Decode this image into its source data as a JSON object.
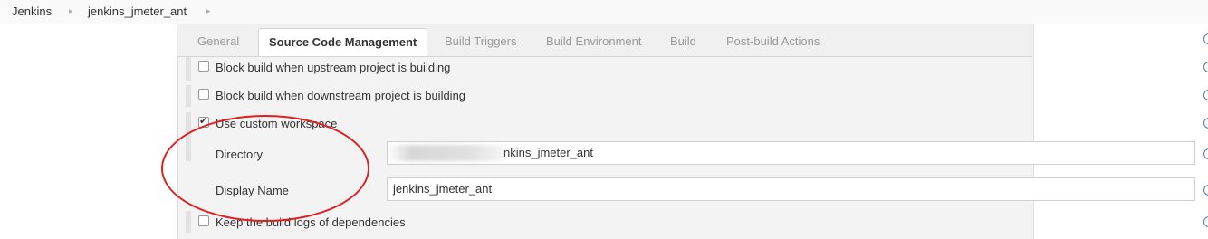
{
  "breadcrumb": {
    "items": [
      {
        "label": "Jenkins"
      },
      {
        "label": "jenkins_jmeter_ant"
      }
    ],
    "separator": "▸"
  },
  "tabs": [
    {
      "label": "General",
      "active": false
    },
    {
      "label": "Source Code Management",
      "active": true
    },
    {
      "label": "Build Triggers",
      "active": false
    },
    {
      "label": "Build Environment",
      "active": false
    },
    {
      "label": "Build",
      "active": false
    },
    {
      "label": "Post-build Actions",
      "active": false
    }
  ],
  "options": {
    "block_upstream": {
      "label": "Block build when upstream project is building",
      "checked": false
    },
    "block_downstream": {
      "label": "Block build when downstream project is building",
      "checked": false
    },
    "custom_workspace": {
      "label": "Use custom workspace",
      "checked": true
    },
    "keep_logs": {
      "label": "Keep the build logs of dependencies",
      "checked": false
    }
  },
  "workspace": {
    "directory_label": "Directory",
    "directory_value": "nkins_jmeter_ant",
    "display_name_label": "Display Name",
    "display_name_value": "jenkins_jmeter_ant"
  },
  "colors": {
    "accent_tab": "#ffffff",
    "annotation": "#e02020",
    "help_icon": "#4a7bbd"
  }
}
